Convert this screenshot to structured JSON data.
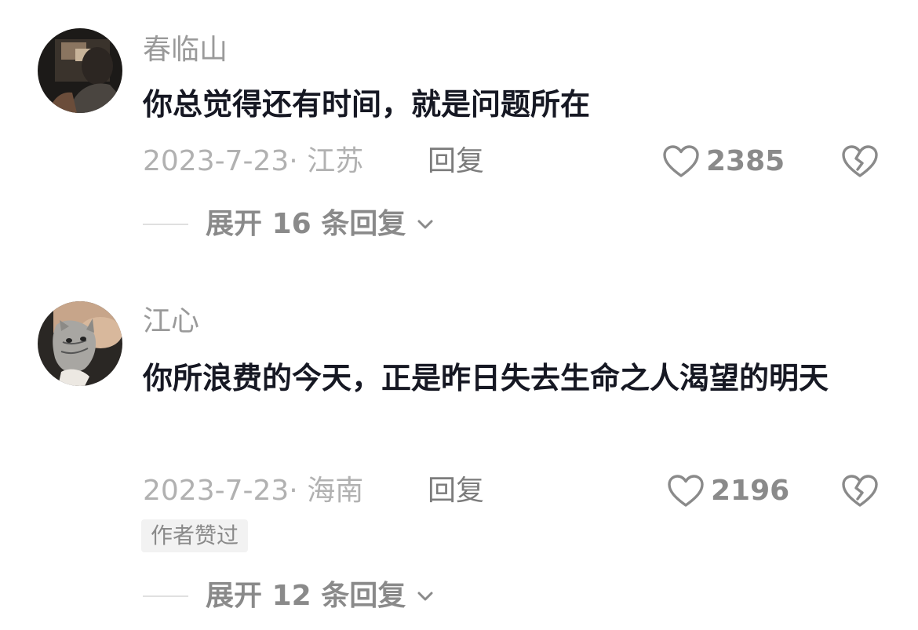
{
  "comments": [
    {
      "username": "春临山",
      "text": "你总觉得还有时间，就是问题所在",
      "date_location": "2023-7-23· 江苏",
      "reply_label": "回复",
      "likes": "2385",
      "expand": {
        "prefix": "展开",
        "count": "16",
        "suffix": "条回复"
      }
    },
    {
      "username": "江心",
      "text": "你所浪费的今天，正是昨日失去生命之人渴望的明天",
      "date_location": "2023-7-23· 海南",
      "reply_label": "回复",
      "likes": "2196",
      "badge": "作者赞过",
      "expand": {
        "prefix": "展开",
        "count": "12",
        "suffix": "条回复"
      }
    }
  ],
  "colors": {
    "username": "#9a9a9a",
    "text": "#161823",
    "meta": "#b1b1b1",
    "icon": "#8a8a8a"
  }
}
